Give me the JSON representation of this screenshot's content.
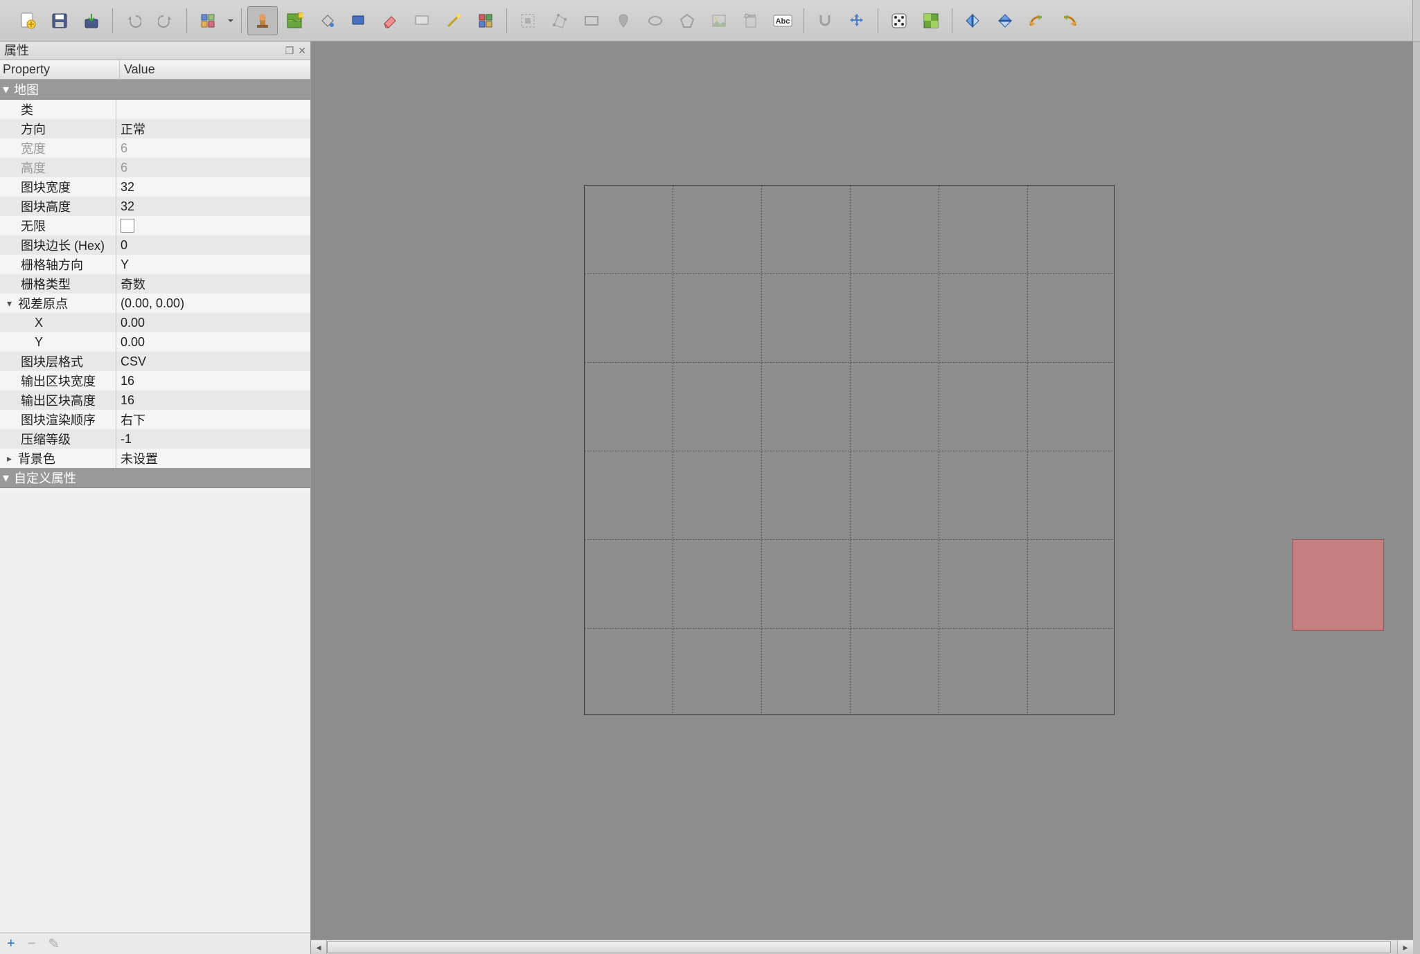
{
  "panel": {
    "title": "属性",
    "col_property": "Property",
    "col_value": "Value",
    "group_map": "地图",
    "group_custom": "自定义属性"
  },
  "props": {
    "class_k": "类",
    "class_v": "",
    "orient_k": "方向",
    "orient_v": "正常",
    "width_k": "宽度",
    "width_v": "6",
    "height_k": "高度",
    "height_v": "6",
    "tilew_k": "图块宽度",
    "tilew_v": "32",
    "tileh_k": "图块高度",
    "tileh_v": "32",
    "infinite_k": "无限",
    "hexside_k": "图块边长 (Hex)",
    "hexside_v": "0",
    "stagaxis_k": "栅格轴方向",
    "stagaxis_v": "Y",
    "stagidx_k": "栅格类型",
    "stagidx_v": "奇数",
    "parallax_k": "视差原点",
    "parallax_v": "(0.00, 0.00)",
    "px_k": "X",
    "px_v": "0.00",
    "py_k": "Y",
    "py_v": "0.00",
    "layerfmt_k": "图块层格式",
    "layerfmt_v": "CSV",
    "chunkw_k": "输出区块宽度",
    "chunkw_v": "16",
    "chunkh_k": "输出区块高度",
    "chunkh_v": "16",
    "render_k": "图块渲染顺序",
    "render_v": "右下",
    "compress_k": "压缩等级",
    "compress_v": "-1",
    "bgcolor_k": "背景色",
    "bgcolor_v": "未设置"
  },
  "toolbar_icons": [
    "new-file-icon",
    "save-icon",
    "export-icon",
    "sep",
    "undo-icon",
    "redo-icon",
    "sep",
    "command-icon",
    "command-dropdown-icon",
    "sep",
    "stamp-icon",
    "terrain-icon",
    "bucket-icon",
    "rect-select-icon",
    "eraser-icon",
    "rect-fill-icon",
    "magic-wand-icon",
    "select-same-icon",
    "sep",
    "insert-tile-icon",
    "edit-polygon-icon",
    "insert-rect-icon",
    "insert-point-icon",
    "insert-ellipse-icon",
    "insert-polygon-icon",
    "insert-image-icon",
    "insert-template-icon",
    "insert-text-icon",
    "sep",
    "snap-icon",
    "move-icon",
    "sep",
    "random-icon",
    "fill-mode-icon",
    "sep",
    "flip-h-icon",
    "flip-v-icon",
    "rotate-l-icon",
    "rotate-r-icon"
  ],
  "map": {
    "cols": 6,
    "rows": 6
  },
  "footer": {
    "add": "+",
    "remove": "−",
    "edit": "✎"
  }
}
